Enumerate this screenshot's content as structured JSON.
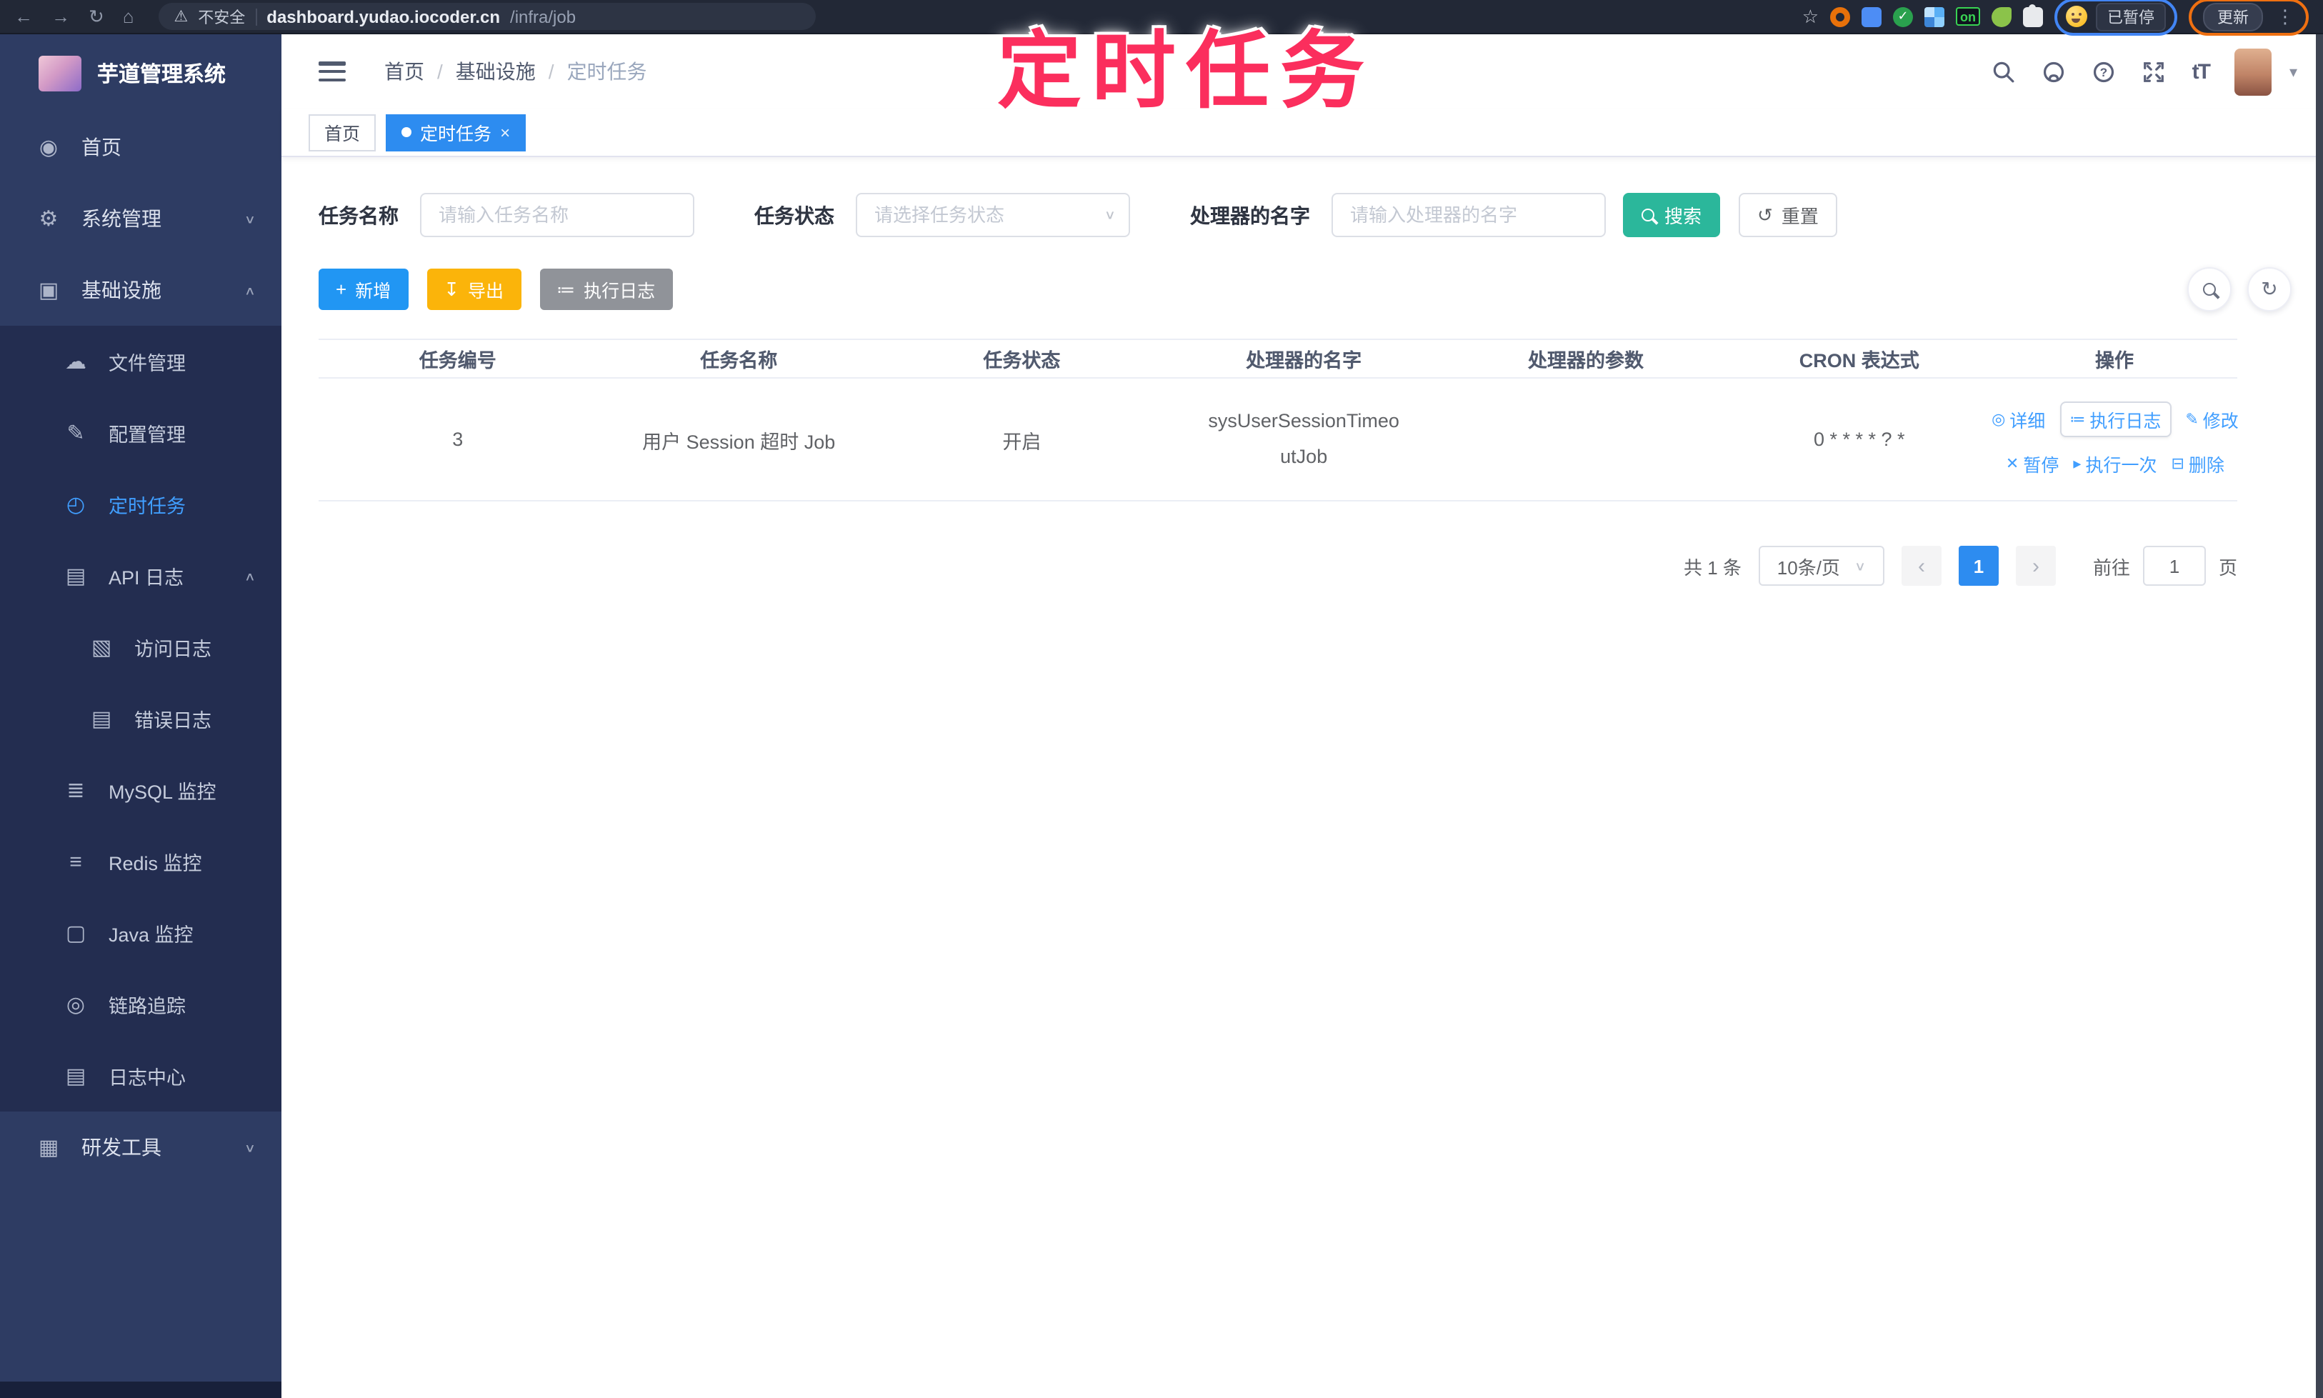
{
  "colors": {
    "primary": "#409eff",
    "tab_active": "#2d8cf0",
    "search_button_teal": "#2bb79b",
    "export_button_amber": "#fbb40a",
    "exec_button_gray": "#909399",
    "annotation_pink": "#fb2e5d",
    "sidebar_bg": "#2e3c63",
    "sidebar_submenu_bg": "#232d50"
  },
  "browser": {
    "back_glyph": "←",
    "forward_glyph": "→",
    "reload_glyph": "↻",
    "home_glyph": "⌂",
    "warning_glyph": "⚠",
    "security_label": "不安全",
    "url_domain": "dashboard.yudao.iocoder.cn",
    "url_path": "/infra/job",
    "star_glyph": "☆",
    "on_badge": "on",
    "paused_chip": "已暂停",
    "update_button": "更新",
    "menu_glyph": "⋮"
  },
  "annotation": {
    "title": "定时任务"
  },
  "sidebar": {
    "app_title": "芋道管理系统",
    "items": [
      {
        "label": "首页",
        "glyph": "◉",
        "icon": "dashboard-icon"
      },
      {
        "label": "系统管理",
        "glyph": "⚙",
        "icon": "gear-icon",
        "arrow": "∨"
      },
      {
        "label": "基础设施",
        "glyph": "▣",
        "icon": "monitor-icon",
        "arrow": "∧"
      },
      {
        "label": "文件管理",
        "glyph": "☁",
        "icon": "cloud-upload-icon"
      },
      {
        "label": "配置管理",
        "glyph": "✎",
        "icon": "edit-icon"
      },
      {
        "label": "定时任务",
        "glyph": "◴",
        "icon": "timer-icon"
      },
      {
        "label": "API 日志",
        "glyph": "▤",
        "icon": "api-log-icon",
        "arrow": "∧"
      },
      {
        "label": "访问日志",
        "glyph": "▧",
        "icon": "access-log-icon"
      },
      {
        "label": "错误日志",
        "glyph": "▤",
        "icon": "error-log-icon"
      },
      {
        "label": "MySQL 监控",
        "glyph": "≣",
        "icon": "mysql-monitor-icon"
      },
      {
        "label": "Redis 监控",
        "glyph": "≡",
        "icon": "redis-monitor-icon"
      },
      {
        "label": "Java 监控",
        "glyph": "▢",
        "icon": "java-monitor-icon"
      },
      {
        "label": "链路追踪",
        "glyph": "◎",
        "icon": "trace-icon"
      },
      {
        "label": "日志中心",
        "glyph": "▤",
        "icon": "log-center-icon"
      },
      {
        "label": "研发工具",
        "glyph": "▦",
        "icon": "dev-tools-icon",
        "arrow": "∨"
      }
    ]
  },
  "header": {
    "breadcrumb": [
      "首页",
      "基础设施",
      "定时任务"
    ],
    "separator": "/",
    "font_size_glyph": "tT",
    "caret_glyph": "▾"
  },
  "tabs": [
    {
      "label": "首页"
    },
    {
      "label": "定时任务",
      "close": "×"
    }
  ],
  "filters": {
    "name_label": "任务名称",
    "name_placeholder": "请输入任务名称",
    "status_label": "任务状态",
    "status_placeholder": "请选择任务状态",
    "select_caret": "∨",
    "handler_label": "处理器的名字",
    "handler_placeholder": "请输入处理器的名字",
    "search_label": "搜索",
    "reset_glyph": "↺",
    "reset_label": "重置"
  },
  "toolbar": {
    "add_glyph": "+",
    "add_label": "新增",
    "export_glyph": "↧",
    "export_label": "导出",
    "exec_glyph": "≔",
    "exec_label": "执行日志",
    "refresh_glyph": "↻"
  },
  "table": {
    "columns": [
      "任务编号",
      "任务名称",
      "任务状态",
      "处理器的名字",
      "处理器的参数",
      "CRON 表达式",
      "操作"
    ],
    "rows": [
      {
        "id": "3",
        "name": "用户 Session 超时 Job",
        "status": "开启",
        "handler": "sysUserSessionTimeoutJob",
        "param": "",
        "cron": "0 * * * * ? *"
      }
    ],
    "actions_line1": [
      {
        "glyph": "◎",
        "label": "详细"
      },
      {
        "glyph": "≔",
        "label": "执行日志"
      },
      {
        "glyph": "✎",
        "label": "修改"
      }
    ],
    "actions_line2": [
      {
        "glyph": "✕",
        "label": "暂停"
      },
      {
        "glyph": "▸",
        "label": "执行一次"
      },
      {
        "glyph": "⊟",
        "label": "删除"
      }
    ]
  },
  "pagination": {
    "total": "共 1 条",
    "page_size": "10条/页",
    "caret": "∨",
    "prev": "‹",
    "current": "1",
    "next": "›",
    "goto_label": "前往",
    "goto_value": "1",
    "page_suffix": "页"
  }
}
